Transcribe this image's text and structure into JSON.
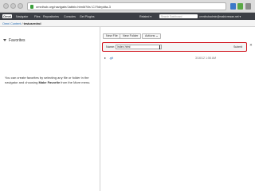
{
  "browser": {
    "url": "omnihub.org/navigate/Jabbix.html#?/le/-C/?ldep#ta-3"
  },
  "app": {
    "logo": "Omni",
    "menu": [
      "Navigator",
      "Files",
      "Repositories",
      "Consoles",
      "Get Plugins"
    ],
    "related": "Related ▾",
    "search_placeholder": "Search Sashboard",
    "user": "omnihubadmin@mabicrewan.net ▾"
  },
  "breadcrumb": {
    "parent": "Omni Content",
    "separator": " / ",
    "current": "testuserdrol"
  },
  "favorites": {
    "title": "Favorites",
    "help_prefix": "You can create favorites by selecting any file or folder in the navigator and choosing ",
    "help_bold": "Make Favorite",
    "help_suffix": " from the More menu."
  },
  "toolbar": {
    "new_file": "New File",
    "new_folder": "New Folder",
    "actions": "Actions"
  },
  "new_file_form": {
    "label": "Name:",
    "value": "index.html",
    "submit": "Submit",
    "close": "✕"
  },
  "files": [
    {
      "name": ".git",
      "date": "3/16/12 1:56 AM"
    }
  ]
}
